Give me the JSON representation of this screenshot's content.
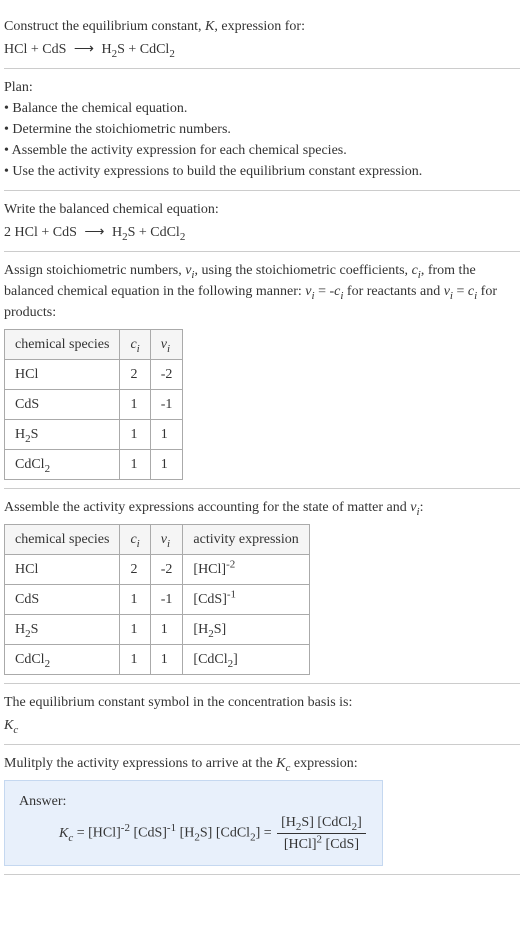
{
  "problem": {
    "prompt": "Construct the equilibrium constant, K, expression for:",
    "equation_unbalanced": "HCl + CdS  ⟶  H₂S + CdCl₂"
  },
  "plan": {
    "heading": "Plan:",
    "bullets": [
      "• Balance the chemical equation.",
      "• Determine the stoichiometric numbers.",
      "• Assemble the activity expression for each chemical species.",
      "• Use the activity expressions to build the equilibrium constant expression."
    ]
  },
  "balanced": {
    "heading": "Write the balanced chemical equation:",
    "equation": "2 HCl + CdS  ⟶  H₂S + CdCl₂"
  },
  "stoich": {
    "heading": "Assign stoichiometric numbers, νᵢ, using the stoichiometric coefficients, cᵢ, from the balanced chemical equation in the following manner: νᵢ = -cᵢ for reactants and νᵢ = cᵢ for products:",
    "headers": [
      "chemical species",
      "cᵢ",
      "νᵢ"
    ],
    "rows": [
      {
        "species": "HCl",
        "c": "2",
        "v": "-2"
      },
      {
        "species": "CdS",
        "c": "1",
        "v": "-1"
      },
      {
        "species": "H₂S",
        "c": "1",
        "v": "1"
      },
      {
        "species": "CdCl₂",
        "c": "1",
        "v": "1"
      }
    ]
  },
  "activity": {
    "heading": "Assemble the activity expressions accounting for the state of matter and νᵢ:",
    "headers": [
      "chemical species",
      "cᵢ",
      "νᵢ",
      "activity expression"
    ],
    "rows": [
      {
        "species": "HCl",
        "c": "2",
        "v": "-2",
        "expr": "[HCl]⁻²"
      },
      {
        "species": "CdS",
        "c": "1",
        "v": "-1",
        "expr": "[CdS]⁻¹"
      },
      {
        "species": "H₂S",
        "c": "1",
        "v": "1",
        "expr": "[H₂S]"
      },
      {
        "species": "CdCl₂",
        "c": "1",
        "v": "1",
        "expr": "[CdCl₂]"
      }
    ]
  },
  "symbol": {
    "heading": "The equilibrium constant symbol in the concentration basis is:",
    "value": "K_c"
  },
  "final": {
    "heading": "Mulitply the activity expressions to arrive at the K_c expression:",
    "answer_label": "Answer:",
    "lhs": "K_c = [HCl]⁻² [CdS]⁻¹ [H₂S] [CdCl₂] = ",
    "num": "[H₂S] [CdCl₂]",
    "den": "[HCl]² [CdS]"
  }
}
